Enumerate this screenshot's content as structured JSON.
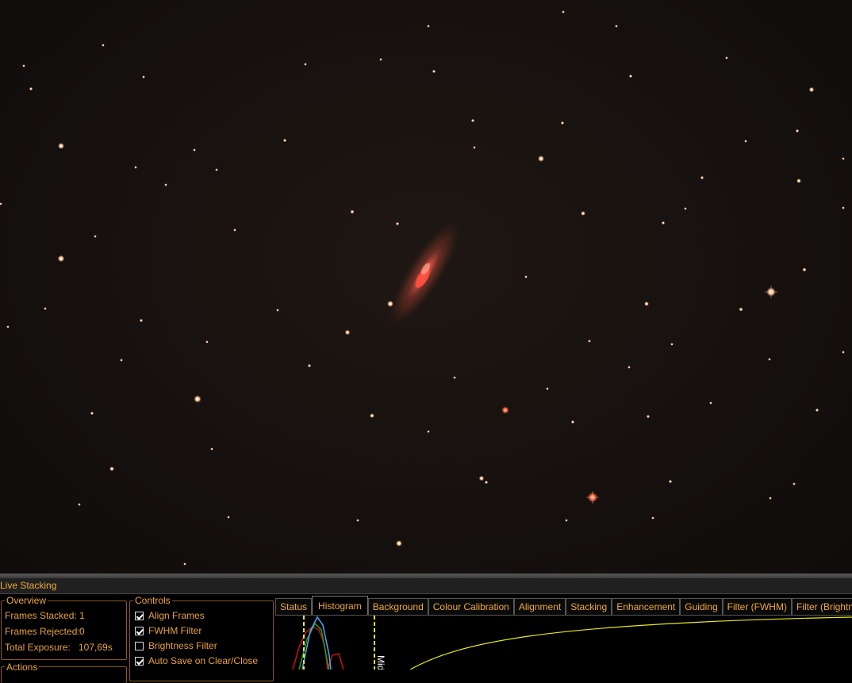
{
  "panel": {
    "title": "Live Stacking",
    "overview": {
      "title": "Overview",
      "frames_stacked_label": "Frames Stacked:",
      "frames_stacked_value": "1",
      "frames_rejected_label": "Frames Rejected:",
      "frames_rejected_value": "0",
      "total_exposure_label": "Total Exposure:",
      "total_exposure_value": "107,69s"
    },
    "actions": {
      "title": "Actions"
    },
    "controls": {
      "title": "Controls",
      "items": [
        {
          "label": "Align Frames",
          "checked": true
        },
        {
          "label": "FWHM Filter",
          "checked": true
        },
        {
          "label": "Brightness Filter",
          "checked": false
        },
        {
          "label": "Auto Save on Clear/Close",
          "checked": true
        }
      ]
    },
    "tabs": [
      {
        "label": "Status",
        "active": false
      },
      {
        "label": "Histogram",
        "active": true
      },
      {
        "label": "Background",
        "active": false
      },
      {
        "label": "Colour Calibration",
        "active": false
      },
      {
        "label": "Alignment",
        "active": false
      },
      {
        "label": "Stacking",
        "active": false
      },
      {
        "label": "Enhancement",
        "active": false
      },
      {
        "label": "Guiding",
        "active": false
      },
      {
        "label": "Filter (FWHM)",
        "active": false
      },
      {
        "label": "Filter (Brightness)",
        "active": false
      }
    ],
    "histogram": {
      "midtone_label": "Mid",
      "colors": {
        "red": "#d01010",
        "green": "#20a020",
        "blue": "#4aa8ff",
        "curve": "#e8e820",
        "marker": "#e8e820",
        "mid_marker": "#ffffff"
      }
    }
  },
  "colors": {
    "accent": "#e8a13a",
    "panel_bg": "#000000",
    "title_bg": "#202020"
  }
}
